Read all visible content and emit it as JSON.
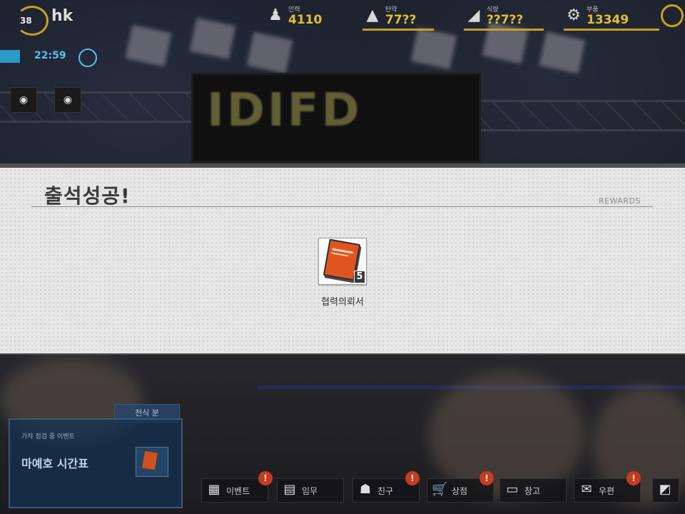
{
  "hud": {
    "level": "38",
    "player_name": "hk",
    "resources": [
      {
        "name": "인력",
        "value": "4110",
        "icon": "manpower-icon"
      },
      {
        "name": "탄약",
        "value": "77??",
        "icon": "ammo-icon"
      },
      {
        "name": "식량",
        "value": "??7??",
        "icon": "ration-icon"
      },
      {
        "name": "부품",
        "value": "13349",
        "icon": "parts-icon"
      }
    ],
    "time": "22:59",
    "colors": {
      "accent": "#c8a020",
      "time": "#58c0e8"
    }
  },
  "modal": {
    "title": "출석성공!",
    "subtitle": "REWARDS",
    "reward": {
      "name": "협력의뢰서",
      "count": "5",
      "icon": "contract-book-icon"
    }
  },
  "banner": {
    "title": "마예호 시간표",
    "subtitle": "가챠 점검 중 이벤트",
    "tag": "천식 분"
  },
  "dock": {
    "items": [
      {
        "label": "이벤트",
        "icon": "grid-icon"
      },
      {
        "label": "임무",
        "icon": "mission-icon"
      },
      {
        "label": "친구",
        "icon": "friend-icon"
      },
      {
        "label": "상점",
        "icon": "shop-icon"
      },
      {
        "label": "창고",
        "icon": "storage-icon"
      },
      {
        "label": "우편",
        "icon": "mail-icon"
      }
    ]
  }
}
